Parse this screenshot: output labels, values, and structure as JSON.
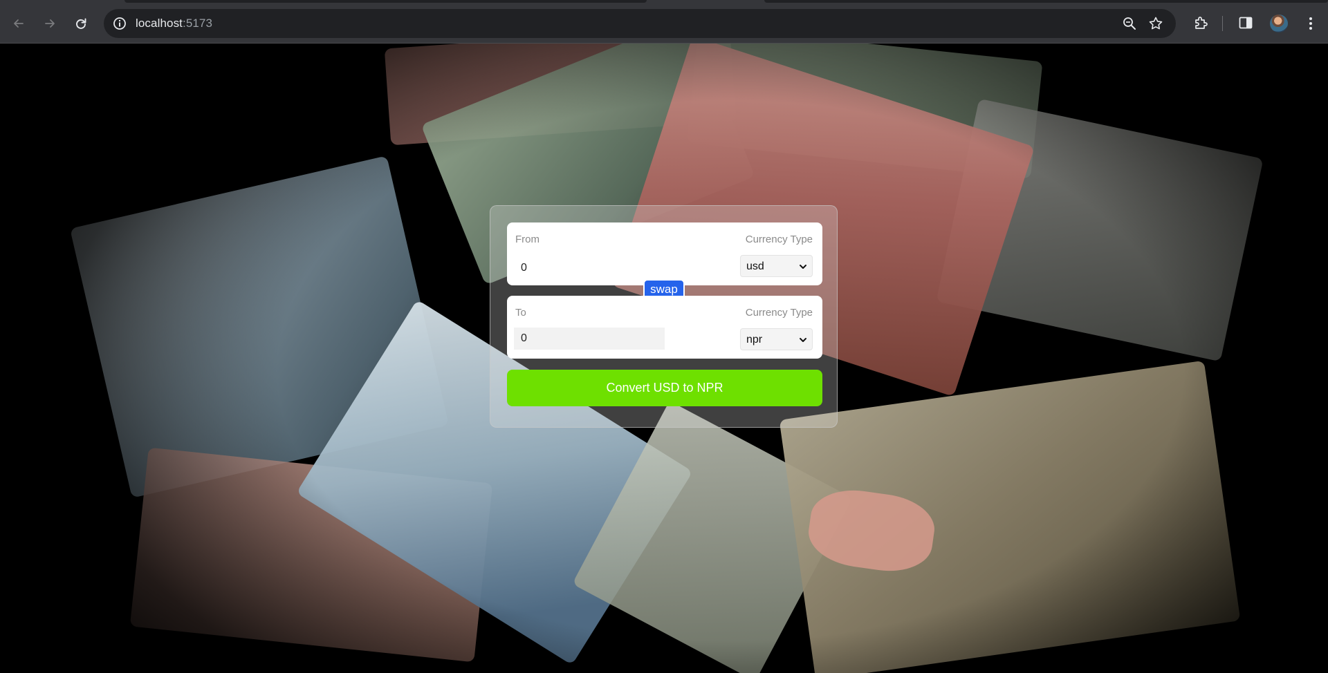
{
  "browser": {
    "url_host": "localhost",
    "url_port": ":5173"
  },
  "converter": {
    "from": {
      "label": "From",
      "currency_type_label": "Currency Type",
      "amount": "0",
      "currency": "usd"
    },
    "swap_label": "swap",
    "to": {
      "label": "To",
      "currency_type_label": "Currency Type",
      "amount": "0",
      "currency": "npr"
    },
    "convert_label": "Convert USD to NPR"
  },
  "colors": {
    "swap_button": "#2563eb",
    "convert_button": "#6ee000",
    "browser_chrome": "#35363a",
    "omnibox": "#202124"
  },
  "icons": [
    "back-arrow-icon",
    "forward-arrow-icon",
    "reload-icon",
    "site-info-icon",
    "zoom-icon",
    "bookmark-star-icon",
    "extensions-icon",
    "side-panel-icon",
    "profile-avatar",
    "browser-menu-icon",
    "chevron-down-icon"
  ]
}
